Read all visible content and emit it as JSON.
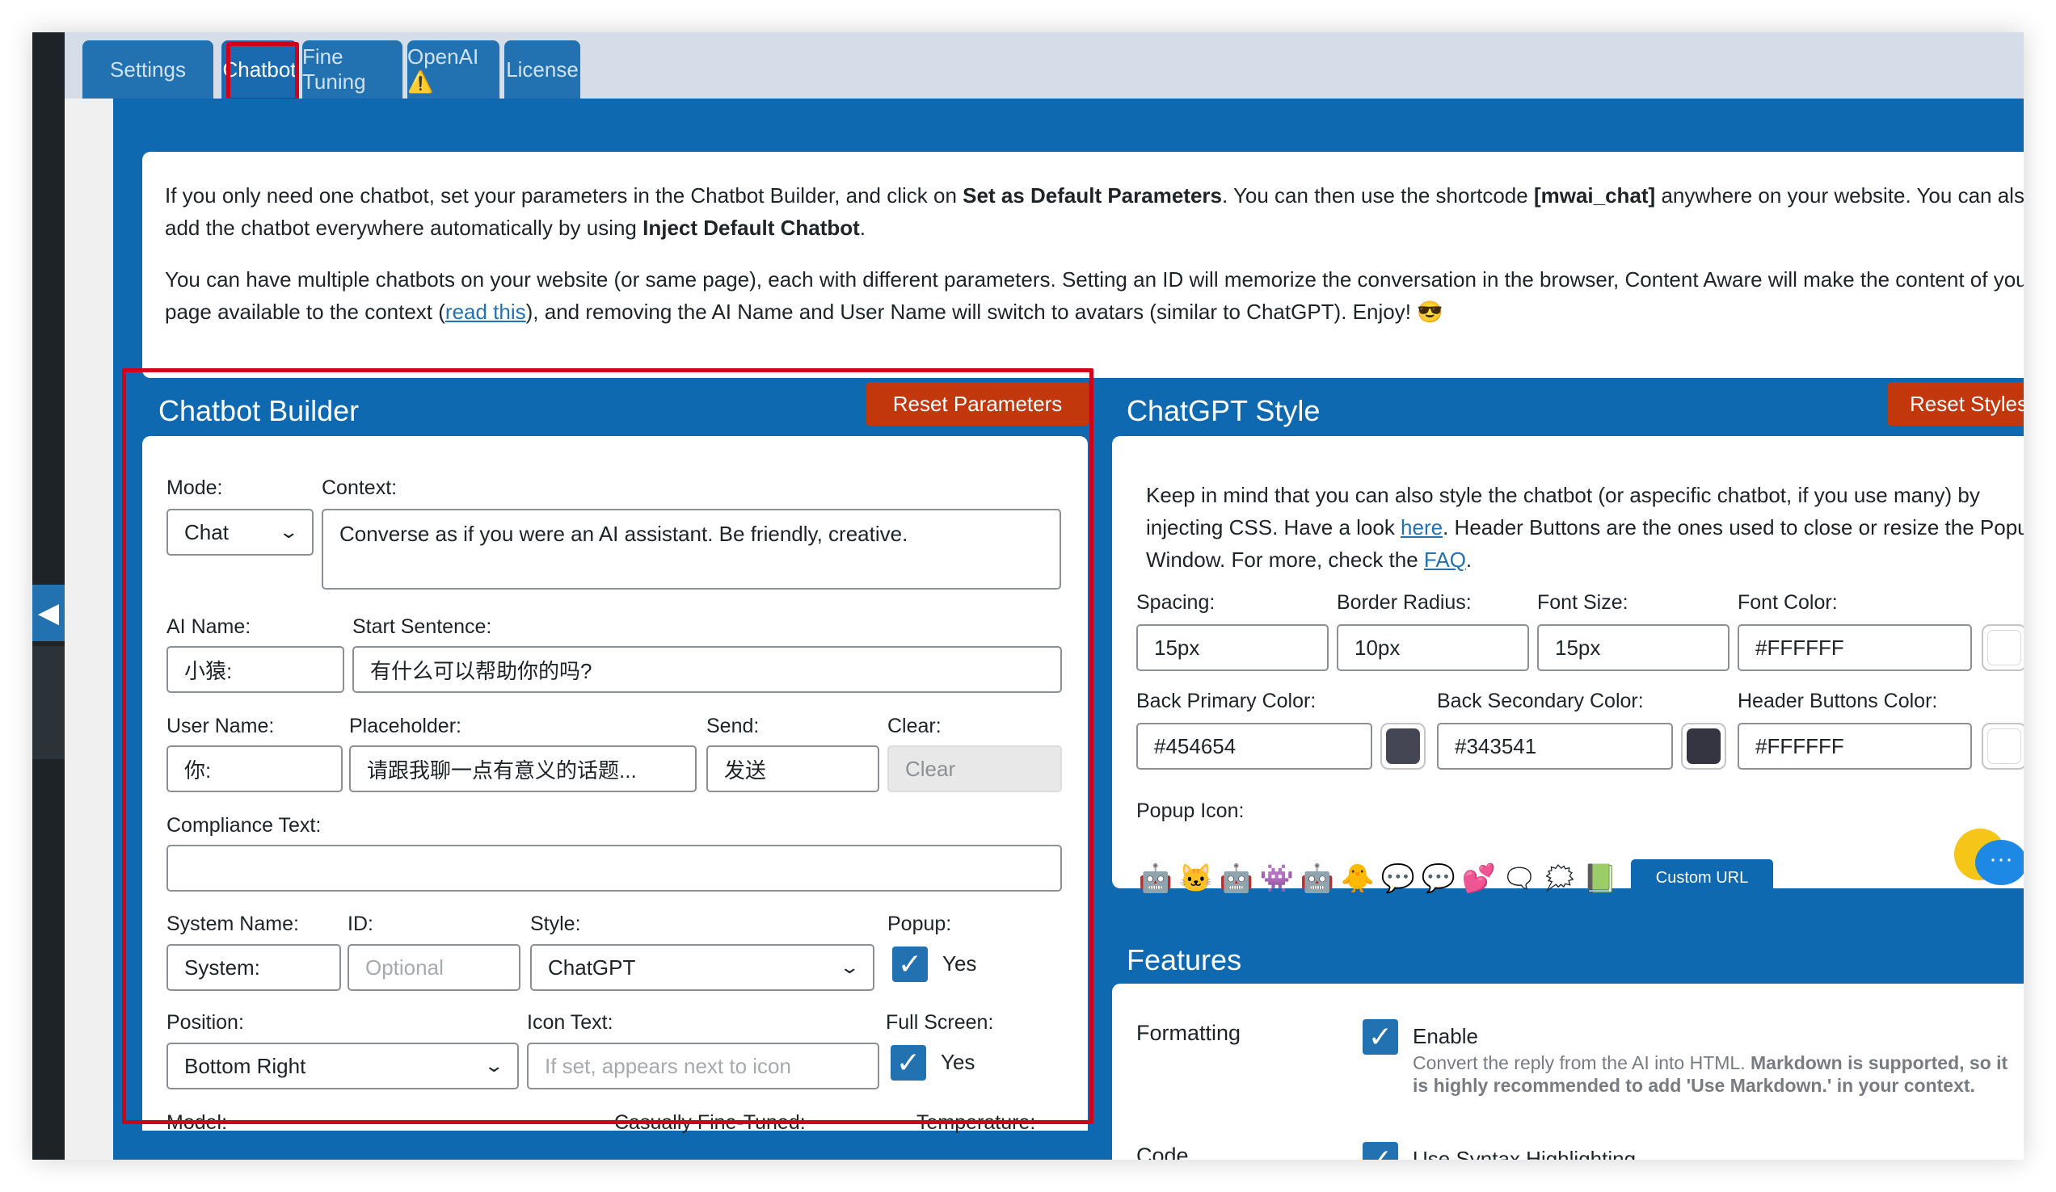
{
  "tabs": [
    {
      "label": "Settings"
    },
    {
      "label": "Chatbot"
    },
    {
      "label": "Fine Tuning"
    },
    {
      "label": "OpenAI ⚠️"
    },
    {
      "label": "License"
    }
  ],
  "intro": {
    "p1_a": "If you only need one chatbot, set your parameters in the Chatbot Builder, and click on ",
    "p1_b": "Set as Default Parameters",
    "p1_c": ". You can then use the shortcode ",
    "p1_d": "[mwai_chat]",
    "p1_e": " anywhere on your website. You can also add the chatbot everywhere automatically by using ",
    "p1_f": "Inject Default Chatbot",
    "p1_g": ".",
    "p2_a": "You can have multiple chatbots on your website (or same page), each with different parameters. Setting an ID will memorize the conversation in the browser, Content Aware will make the content of your page available to the context (",
    "p2_link": "read this",
    "p2_b": "), and removing the AI Name and User Name will switch to avatars (similar to ChatGPT). Enjoy! 😎"
  },
  "builder": {
    "title": "Chatbot Builder",
    "reset_label": "Reset Parameters",
    "mode": {
      "label": "Mode:",
      "value": "Chat"
    },
    "context": {
      "label": "Context:",
      "value": "Converse as if you were an AI assistant. Be friendly, creative."
    },
    "ai_name": {
      "label": "AI Name:",
      "value": "小猿:"
    },
    "start_sentence": {
      "label": "Start Sentence:",
      "value": "有什么可以帮助你的吗?"
    },
    "user_name": {
      "label": "User Name:",
      "value": "你:"
    },
    "placeholder": {
      "label": "Placeholder:",
      "value": "请跟我聊一点有意义的话题..."
    },
    "send": {
      "label": "Send:",
      "value": "发送"
    },
    "clear": {
      "label": "Clear:",
      "value": "Clear"
    },
    "compliance": {
      "label": "Compliance Text:",
      "value": ""
    },
    "system_name": {
      "label": "System Name:",
      "value": "System:"
    },
    "id": {
      "label": "ID:",
      "placeholder": "Optional"
    },
    "style": {
      "label": "Style:",
      "value": "ChatGPT"
    },
    "popup": {
      "label": "Popup:",
      "check_label": "Yes",
      "checked": true
    },
    "position": {
      "label": "Position:",
      "value": "Bottom Right"
    },
    "icon_text": {
      "label": "Icon Text:",
      "placeholder": "If set, appears next to icon"
    },
    "full_screen": {
      "label": "Full Screen:",
      "check_label": "Yes",
      "checked": true
    },
    "model": {
      "label": "Model:"
    },
    "casually_fine_tuned": {
      "label": "Casually Fine-Tuned:"
    },
    "temperature": {
      "label": "Temperature:"
    }
  },
  "style_panel": {
    "title": "ChatGPT Style",
    "reset_label": "Reset Styles",
    "desc_a": "Keep in mind that you can also style the chatbot (or aspecific chatbot, if you use many) by injecting CSS. Have a look ",
    "desc_link1": "here",
    "desc_b": ". Header Buttons are the ones used to close or resize the Popup Window. For more, check the ",
    "desc_link2": "FAQ",
    "desc_c": ".",
    "spacing": {
      "label": "Spacing:",
      "value": "15px"
    },
    "border_radius": {
      "label": "Border Radius:",
      "value": "10px"
    },
    "font_size": {
      "label": "Font Size:",
      "value": "15px"
    },
    "font_color": {
      "label": "Font Color:",
      "value": "#FFFFFF"
    },
    "back_primary": {
      "label": "Back Primary Color:",
      "value": "#454654"
    },
    "back_secondary": {
      "label": "Back Secondary Color:",
      "value": "#343541"
    },
    "header_buttons": {
      "label": "Header Buttons Color:",
      "value": "#FFFFFF"
    },
    "popup_icon": {
      "label": "Popup Icon:"
    },
    "custom_url_label": "Custom URL",
    "icons": [
      "robot-red-icon",
      "cat-icon",
      "robot-purple-icon",
      "robot-dark-icon",
      "robot-blue-icon",
      "robot-yellow-icon",
      "chat-bubbles-blue-icon",
      "chat-bubbles-green-icon",
      "chat-hearts-icon",
      "chat-outline-icon",
      "chat-outline-two-icon",
      "chat-green-icon"
    ]
  },
  "features": {
    "title": "Features",
    "formatting": {
      "label": "Formatting",
      "check_label": "Enable",
      "help_a": "Convert the reply from the AI into HTML. ",
      "help_b": "Markdown is supported, so it is highly recommended to add 'Use Markdown.' in your context."
    },
    "code": {
      "label": "Code",
      "check_label": "Use Syntax Highlighting"
    }
  },
  "colors": {
    "accent": "#2271b1",
    "panel_blue": "#0f69b0",
    "reset_red": "#c2370c",
    "highlight_red": "#d0021b",
    "swatch_primary": "#454654",
    "swatch_secondary": "#343541",
    "swatch_white": "#FFFFFF"
  }
}
